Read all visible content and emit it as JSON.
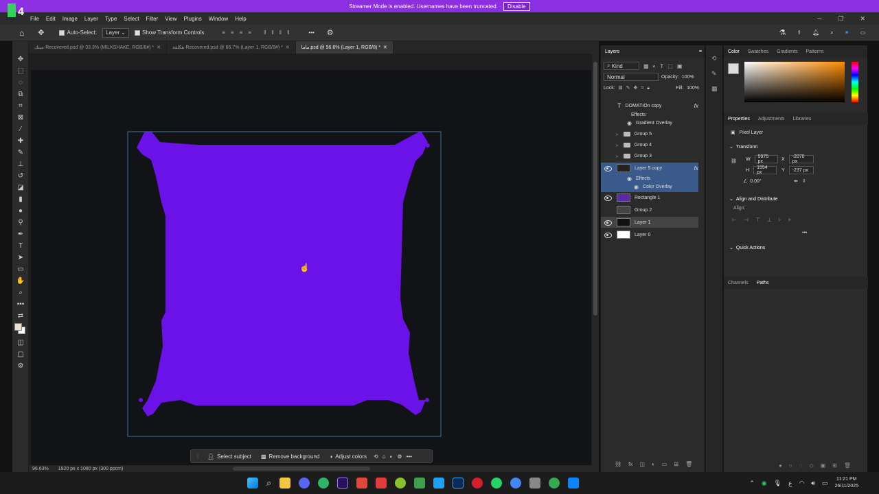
{
  "banner": {
    "text": "Streamer Mode is enabled. Usernames have been truncated.",
    "button": "Disable"
  },
  "logo": "4",
  "menu": [
    "File",
    "Edit",
    "Image",
    "Layer",
    "Type",
    "Select",
    "Filter",
    "View",
    "Plugins",
    "Window",
    "Help"
  ],
  "options": {
    "auto_select": "Auto-Select:",
    "layer_select": "Layer",
    "show_transform": "Show Transform Controls"
  },
  "tabs": [
    {
      "label": "مينك-Recovered.psd @ 33.3% (MILKSHAKE, RGB/8#) *"
    },
    {
      "label": "هكلفة-Recovered.psd @ 66.7% (Layer 1, RGB/8#) *"
    },
    {
      "label": "ماما.psd @ 96.6% (Layer 1, RGB/8) *"
    }
  ],
  "status": {
    "zoom": "96.63%",
    "doc": "1920 px x 1080 px (300 ppcm)"
  },
  "context_bar": {
    "select_subject": "Select subject",
    "remove_bg": "Remove background",
    "adjust_colors": "Adjust colors"
  },
  "layers": {
    "title": "Layers",
    "filter": "Kind",
    "blend": "Normal",
    "opacity_label": "Opacity:",
    "opacity": "100%",
    "lock_label": "Lock:",
    "fill_label": "Fill:",
    "fill": "100%",
    "items": [
      {
        "name": "DOMATIOn copy"
      },
      {
        "name": "Effects"
      },
      {
        "name": "Gradient Overlay"
      },
      {
        "name": "Group 5"
      },
      {
        "name": "Group 4"
      },
      {
        "name": "Group 3"
      },
      {
        "name": "Layer 5 copy"
      },
      {
        "name": "Effects"
      },
      {
        "name": "Color Overlay"
      },
      {
        "name": "Rectangle 1"
      },
      {
        "name": "Group 2"
      },
      {
        "name": "Layer 1"
      },
      {
        "name": "Layer 0"
      }
    ]
  },
  "color_panel": {
    "tabs": [
      "Color",
      "Swatches",
      "Gradients",
      "Patterns"
    ]
  },
  "props_panel": {
    "tabs": [
      "Properties",
      "Adjustments",
      "Libraries"
    ],
    "pixel_layer": "Pixel Layer",
    "transform": "Transform",
    "w_label": "W",
    "w": "5975 px",
    "x_label": "X",
    "x": "-2070 px",
    "h_label": "H",
    "h": "1554 px",
    "y_label": "Y",
    "y": "-237 px",
    "angle": "0.00°",
    "align": "Align and Distribute",
    "align_label": "Align:",
    "quick": "Quick Actions"
  },
  "paths_panel": {
    "tabs": [
      "Channels",
      "Paths"
    ]
  },
  "clock": {
    "time": "11:21 PM",
    "date": "26/11/2025"
  },
  "taskbar_lang": "ع",
  "colors": {
    "purple": "#6a12e8",
    "accent": "#1473e6"
  }
}
